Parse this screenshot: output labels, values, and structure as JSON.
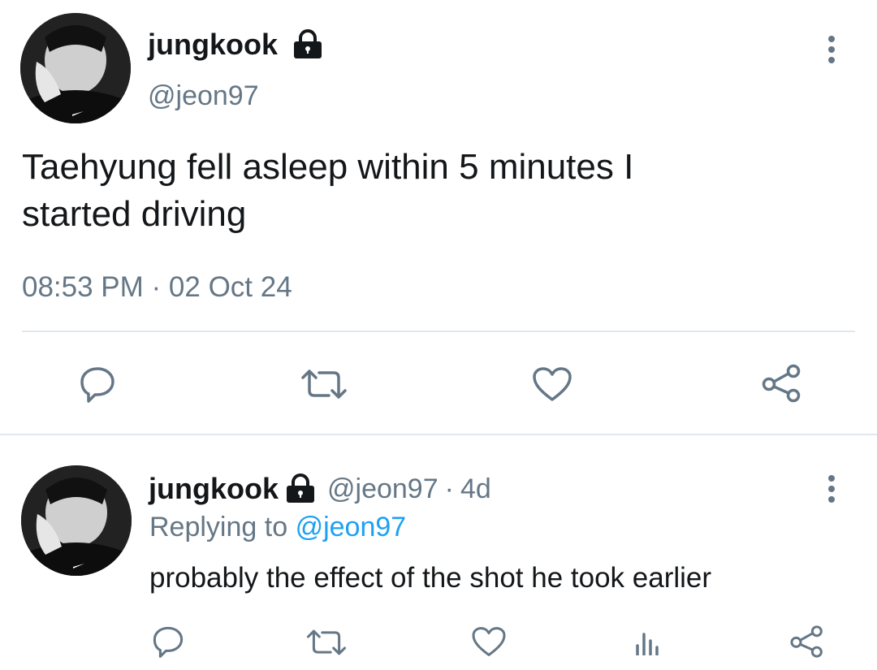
{
  "tweet": {
    "author_name": "jungkook",
    "author_handle": "@jeon97",
    "text_line1": "Taehyung fell asleep within 5 minutes I",
    "text_line2": "started driving",
    "timestamp": "08:53 PM · 02 Oct 24",
    "avatar": "profile-photo",
    "lock_icon": "lock-icon",
    "actions": [
      "reply-icon",
      "retweet-icon",
      "like-icon",
      "share-icon"
    ]
  },
  "reply": {
    "author_name": "jungkook",
    "author_handle": "@jeon97",
    "separator": "·",
    "age": "4d",
    "replying_prefix": "Replying to",
    "replying_handle": "@jeon97",
    "text": "probably the effect of the shot he took earlier",
    "actions": [
      "reply-icon",
      "retweet-icon",
      "like-icon",
      "analytics-icon",
      "share-icon"
    ]
  },
  "colors": {
    "text": "#14171a",
    "muted": "#657786",
    "link": "#1da1f2",
    "divider": "#e1e8ed"
  }
}
